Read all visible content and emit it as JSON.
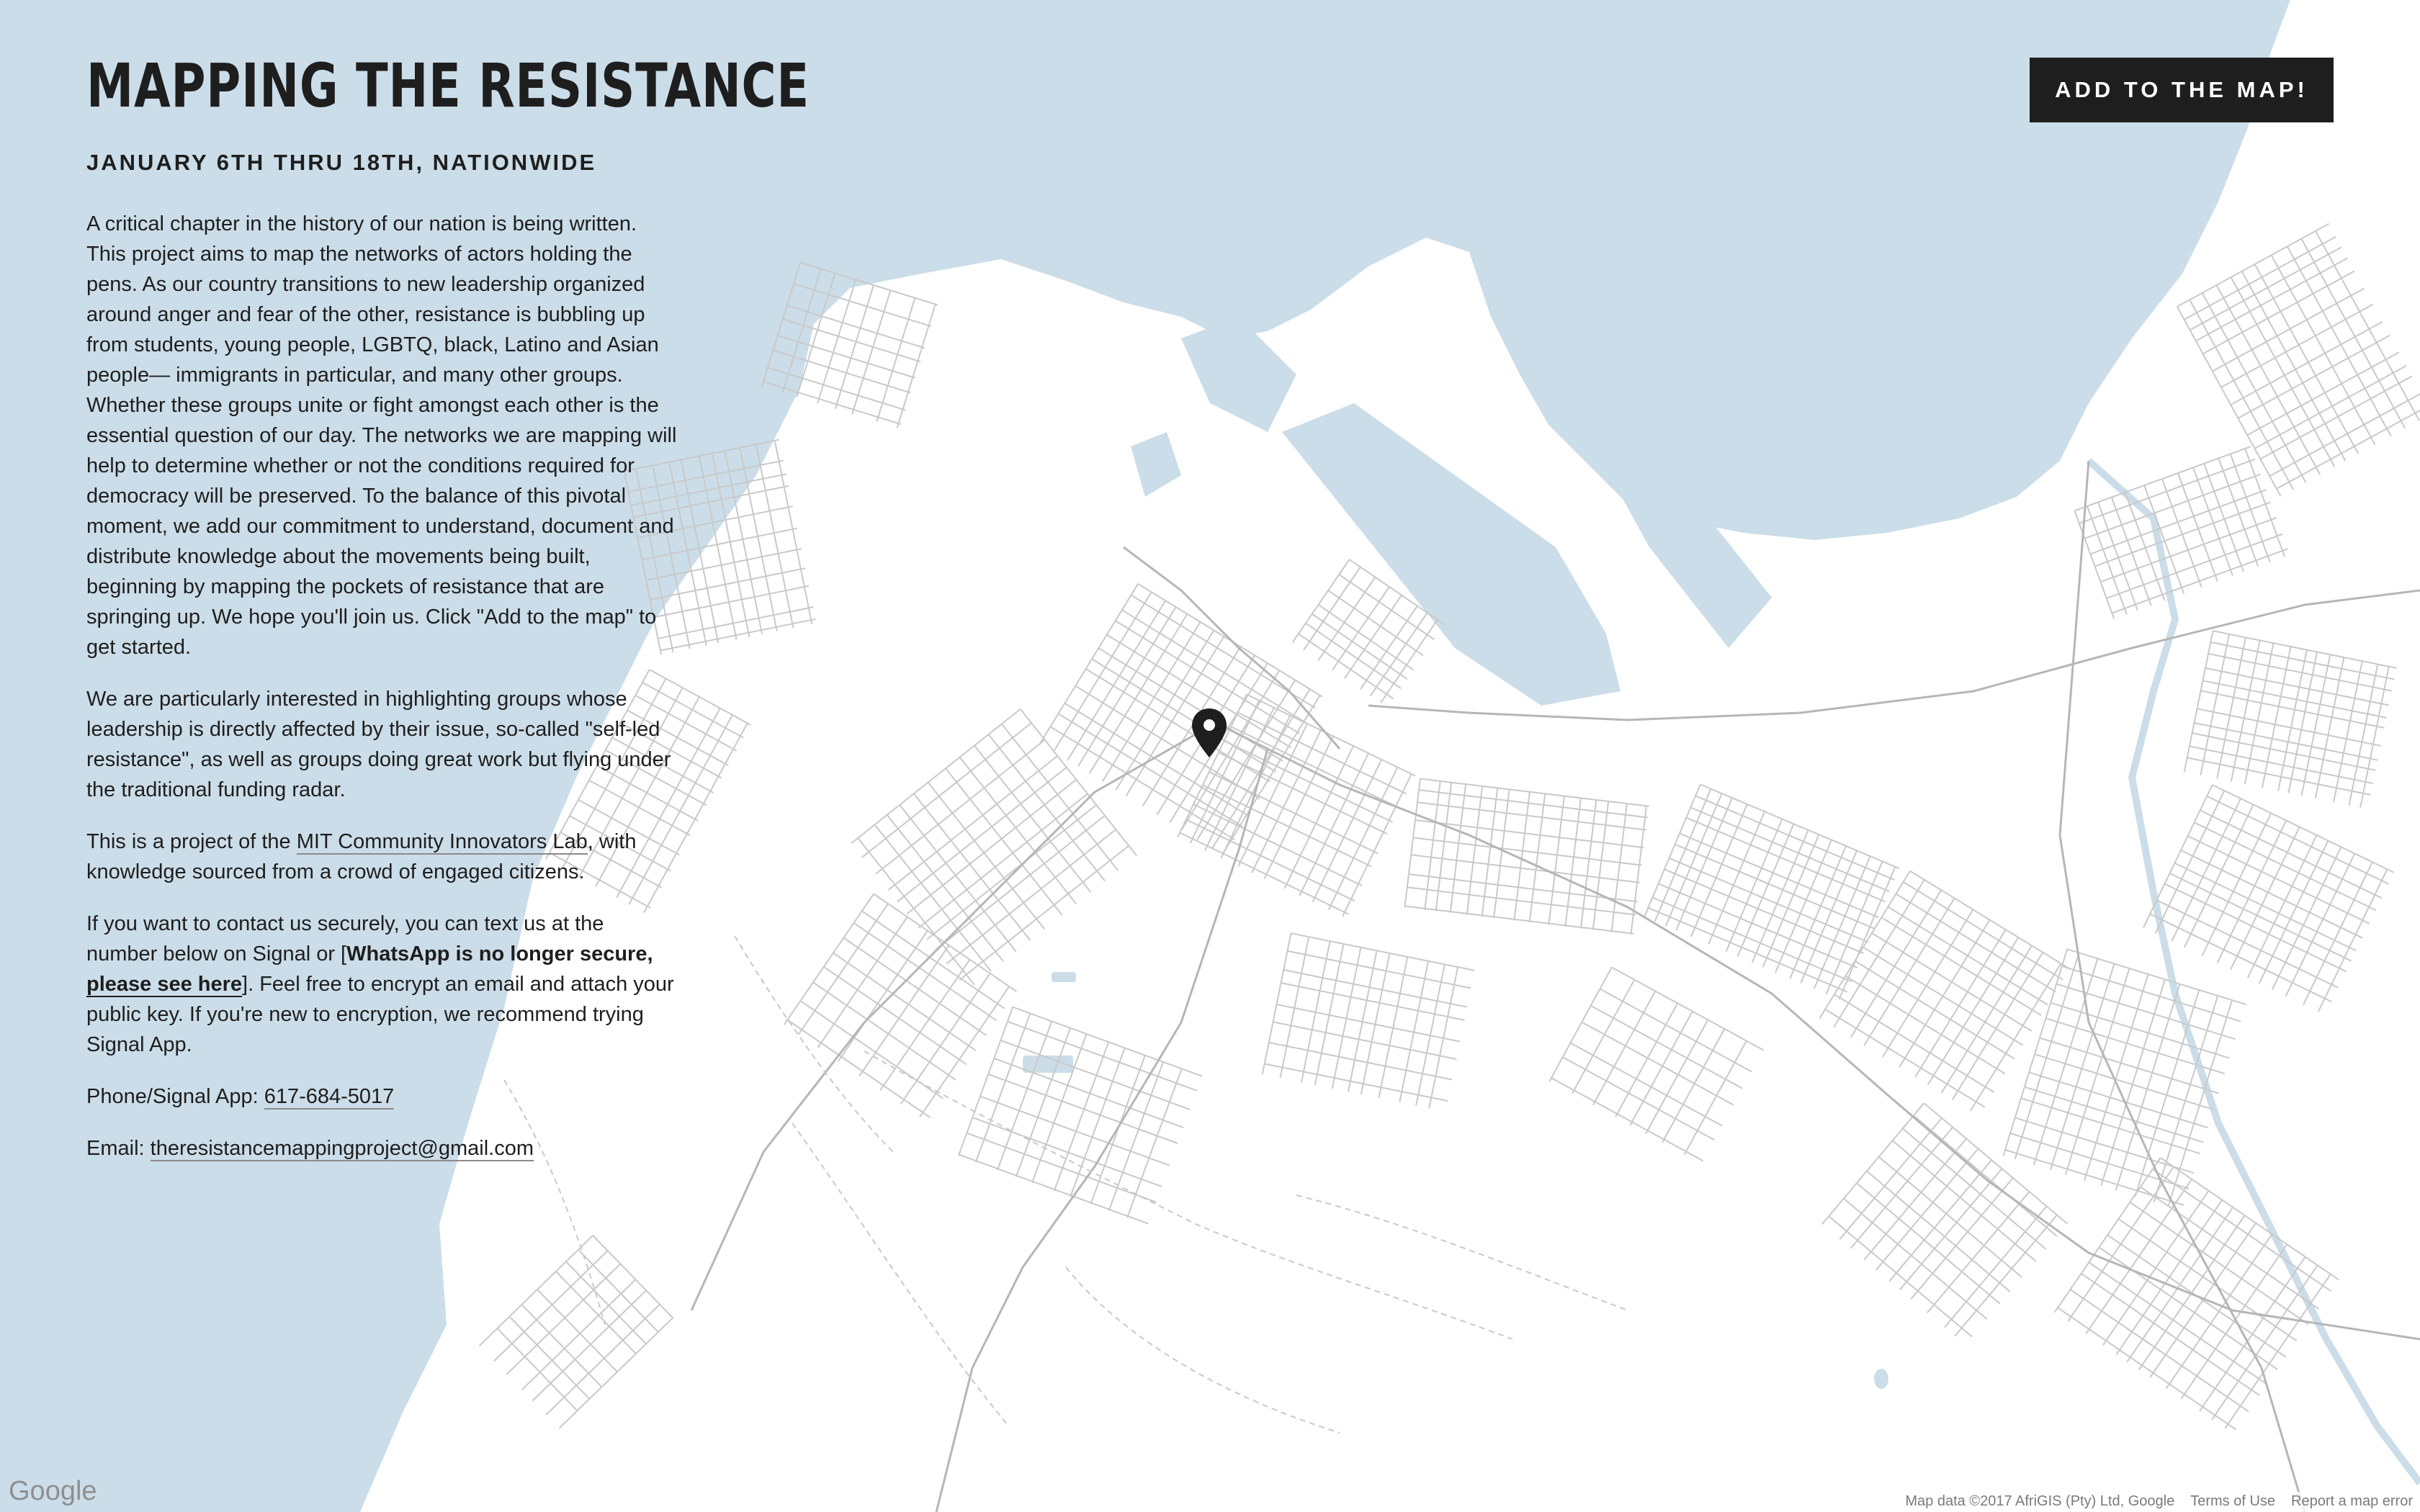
{
  "header": {
    "title": "MAPPING THE RESISTANCE",
    "subtitle": "JANUARY 6TH THRU 18TH, NATIONWIDE",
    "add_button_label": "ADD TO THE MAP!"
  },
  "intro": {
    "paragraph1": "A critical chapter in the history of our nation is being written. This project aims to map the networks of actors holding the pens. As our country transitions to new leadership organized around anger and fear of the other, resistance is bubbling up from students, young people, LGBTQ, black, Latino and Asian people— immigrants in particular, and many other groups. Whether these groups unite or fight amongst each other is the essential question of our day. The networks we are mapping will help to determine whether or not the conditions required for democracy will be preserved.  To the balance of this pivotal moment, we add our commitment to understand, document and distribute knowledge about the movements being built, beginning by mapping the pockets of resistance that are springing up. We hope you'll join us. Click \"Add to the map\" to get started.",
    "paragraph2": "We are particularly interested in highlighting groups whose leadership is directly affected by their issue, so-called \"self-led resistance\", as well as groups doing great work but flying under the traditional funding radar.",
    "p3_before": "This is a project of the ",
    "p3_link": "MIT Community Innovators Lab",
    "p3_after": ", with knowledge sourced from a crowd of engaged citizens.",
    "p4_before": "If you want to contact us securely, you can text us at the number below on Signal or [",
    "p4_bold": "WhatsApp is no longer secure, ",
    "p4_link": "please see here",
    "p4_after": "]. Feel free to encrypt an email and attach your public key. If you're new to encryption, we recommend trying Signal App.",
    "phone_label": "Phone/Signal App: ",
    "phone_value": "617-684-5017",
    "email_label": "Email: ",
    "email_value": "theresistancemappingproject@gmail.com"
  },
  "map": {
    "provider_logo": "Google",
    "attribution": "Map data ©2017 AfriGIS (Pty) Ltd, Google",
    "terms_label": "Terms of Use",
    "report_label": "Report a map error",
    "marker_icon": "map-pin-icon",
    "colors": {
      "water": "#cbdde8",
      "land": "#ffffff",
      "road": "#c6c6c6",
      "marker": "#1e1e1e",
      "button": "#1e1e1e"
    }
  }
}
